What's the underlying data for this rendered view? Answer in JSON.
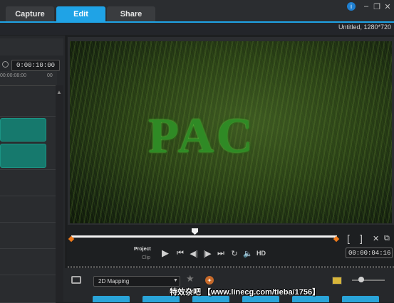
{
  "header": {
    "tabs": [
      {
        "label": "Capture",
        "active": false
      },
      {
        "label": "Edit",
        "active": true
      },
      {
        "label": "Share",
        "active": false
      }
    ],
    "project_info": "Untitled, 1280*720",
    "window_buttons": [
      "minimize",
      "restore",
      "close"
    ]
  },
  "timeline": {
    "timecode": "0:00:10:00",
    "ruler": [
      "00:00:08:00",
      "00"
    ]
  },
  "preview": {
    "title_text": "PAC"
  },
  "playback": {
    "mode_project": "Project",
    "mode_clip": "Clip",
    "hd_label": "HD",
    "timecode": "00:00:04:16",
    "controls": [
      "play",
      "to-start",
      "prev-frame",
      "next-frame",
      "to-end",
      "repeat",
      "volume"
    ]
  },
  "library": {
    "filter_value": "2D Mapping"
  },
  "watermark": "特效杂吧 【www.linecg.com/tieba/1756】",
  "colors": {
    "accent": "#1fa3e6",
    "clip": "#16796d",
    "marker": "#f07a1a"
  }
}
